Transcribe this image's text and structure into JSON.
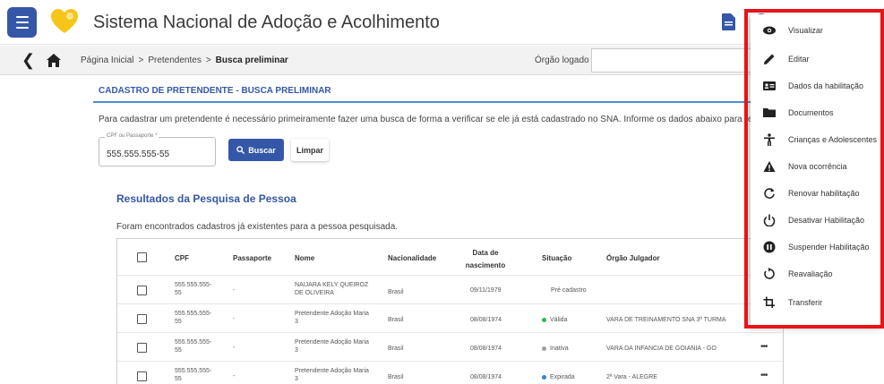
{
  "app": {
    "title": "Sistema Nacional de Adoção e Acolhimento",
    "brand_color": "#3557a7",
    "logo_color": "#f5c518"
  },
  "breadcrumb": {
    "items": [
      "Página Inicial",
      "Pretendentes",
      "Busca preliminar"
    ],
    "separator": ">",
    "orgao_label": "Órgão logado",
    "orgao_value": ""
  },
  "main": {
    "section_title": "CADASTRO DE PRETENDENTE - BUSCA PRELIMINAR",
    "intro": "Para cadastrar um pretendente é necessário primeiramente fazer uma busca de forma a verificar se ele já está cadastrado no SNA. Informe os dados abaixo para realizar essa pesquisa",
    "cpf_field": {
      "label": "CPF ou Passaporte *",
      "value": "555.555.555-55"
    },
    "search_button": "Buscar",
    "clear_button": "Limpar",
    "results_title": "Resultados da Pesquisa de Pessoa",
    "results_subtitle": "Foram encontrados cadastros já existentes para a pessoa pesquisada."
  },
  "table": {
    "headers": {
      "cpf": "CPF",
      "passaporte": "Passaporte",
      "nome": "Nome",
      "nacionalidade": "Nacionalidade",
      "nascimento_l1": "Data de",
      "nascimento_l2": "nascimento",
      "situacao": "Situação",
      "orgao": "Órgão Julgador"
    },
    "rows": [
      {
        "cpf_l1": "555.555.555-",
        "cpf_l2": "55",
        "passaporte": "-",
        "nome_l1": "NAIJARA KELY QUEIROZ",
        "nome_l2": "DE OLIVEIRA",
        "nacionalidade": "Brasil",
        "nascimento": "09/11/1979",
        "situacao": "Pré cadastro",
        "status_color": "",
        "orgao": "",
        "more": "•••"
      },
      {
        "cpf_l1": "555.555.555-",
        "cpf_l2": "55",
        "passaporte": "-",
        "nome_l1": "Pretendente Adoção Maria",
        "nome_l2": "3",
        "nacionalidade": "Brasil",
        "nascimento": "08/08/1974",
        "situacao": "Válida",
        "status_color": "#2eb84a",
        "orgao": "VARA DE TREINAMENTO SNA 3ª TURMA",
        "more": "•••"
      },
      {
        "cpf_l1": "555.555.555-",
        "cpf_l2": "55",
        "passaporte": "-",
        "nome_l1": "Pretendente Adoção Maria",
        "nome_l2": "3",
        "nacionalidade": "Brasil",
        "nascimento": "08/08/1974",
        "situacao": "Inativa",
        "status_color": "#9e9e9e",
        "orgao": "VARA DA INFANCIA DE GOIANIA - GO",
        "more": "•••"
      },
      {
        "cpf_l1": "555.555.555-",
        "cpf_l2": "55",
        "passaporte": "-",
        "nome_l1": "Pretendente Adoção Maria",
        "nome_l2": "3",
        "nacionalidade": "Brasil",
        "nascimento": "08/08/1974",
        "situacao": "Expirada",
        "status_color": "#2f86d6",
        "orgao": "2ª Vara - ALEGRE",
        "more": "•••"
      }
    ]
  },
  "context_menu": {
    "highlight_color": "#e8131b",
    "items": [
      {
        "label": "Visualizar",
        "icon": "eye-icon"
      },
      {
        "label": "Editar",
        "icon": "pencil-icon"
      },
      {
        "label": "Dados da habilitação",
        "icon": "id-card-icon"
      },
      {
        "label": "Documentos",
        "icon": "folder-icon"
      },
      {
        "label": "Crianças e Adolescentes",
        "icon": "person-icon"
      },
      {
        "label": "Nova ocorrência",
        "icon": "warning-icon"
      },
      {
        "label": "Renovar habilitação",
        "icon": "refresh-icon"
      },
      {
        "label": "Desativar Habilitação",
        "icon": "power-icon"
      },
      {
        "label": "Suspender Habilitação",
        "icon": "pause-circle-icon"
      },
      {
        "label": "Reavaliação",
        "icon": "rotate-icon"
      },
      {
        "label": "Transferir",
        "icon": "transfer-icon"
      }
    ]
  }
}
